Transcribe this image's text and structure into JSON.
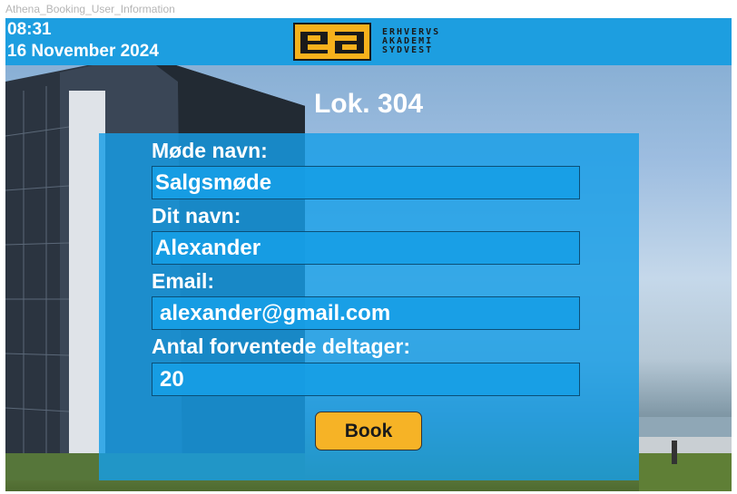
{
  "frame": {
    "title": "Athena_Booking_User_Information"
  },
  "header": {
    "time": "08:31",
    "date": "16 November 2024",
    "logo": {
      "mark": "ea",
      "lines": [
        "ERHVERVS",
        "AKADEMI",
        "SYDVEST"
      ]
    }
  },
  "room": "Lok. 304",
  "form": {
    "meeting_name_label": "Møde navn:",
    "meeting_name_value": "Salgsmøde",
    "your_name_label": "Dit navn:",
    "your_name_value": "Alexander",
    "email_label": "Email:",
    "email_value": "alexander@gmail.com",
    "attendees_label": "Antal forventede deltager:",
    "attendees_value": "20",
    "book_label": "Book"
  },
  "colors": {
    "header_blue": "#1d9ee0",
    "panel_blue": "#169ee6",
    "button_yellow": "#f6b326",
    "logo_yellow": "#f6b11c"
  }
}
